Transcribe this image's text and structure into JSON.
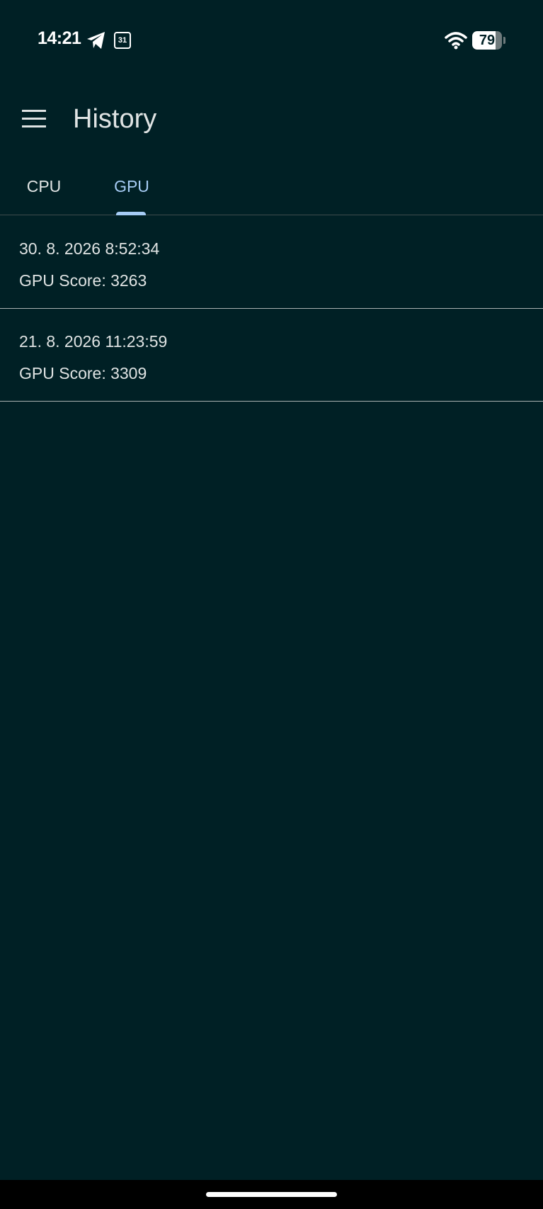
{
  "status_bar": {
    "time": "14:21",
    "calendar_day": "31",
    "battery_level": "79",
    "battery_fraction": 0.79
  },
  "app_bar": {
    "title": "History",
    "menu_icon": "hamburger-menu-icon"
  },
  "tabs": [
    {
      "label": "CPU",
      "selected": false
    },
    {
      "label": "GPU",
      "selected": true
    }
  ],
  "history": [
    {
      "date": "30. 8. 2026 8:52:34",
      "score": "GPU Score: 3263"
    },
    {
      "date": "21. 8. 2026 11:23:59",
      "score": "GPU Score: 3309"
    }
  ],
  "colors": {
    "background": "#002025",
    "accent": "#a6ccf5",
    "text": "#dfe3e3"
  }
}
